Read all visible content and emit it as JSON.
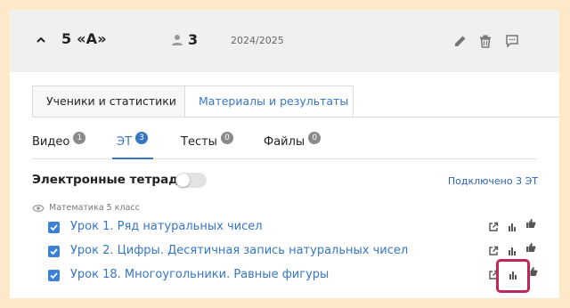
{
  "header": {
    "class_name": "5 «А»",
    "student_count": "3",
    "year": "2024/2025",
    "icons": [
      "chevron-up-icon",
      "person-icon",
      "pencil-icon",
      "trash-icon",
      "comment-icon"
    ]
  },
  "tabs": [
    {
      "label": "Ученики и статистики",
      "active": false
    },
    {
      "label": "Материалы и результаты",
      "active": true
    }
  ],
  "sub_tabs": [
    {
      "label": "Видео",
      "count": "1",
      "active": false
    },
    {
      "label": "ЭТ",
      "count": "3",
      "active": true
    },
    {
      "label": "Тесты",
      "count": "0",
      "active": false
    },
    {
      "label": "Файлы",
      "count": "0",
      "active": false
    }
  ],
  "section": {
    "title": "Электронные тетради",
    "toggle_on": false,
    "connected": "Подключено 3 ЭТ"
  },
  "subject": "Математика 5 класс",
  "lessons": [
    {
      "title": "Урок 1. Ряд натуральных чисел",
      "checked": true
    },
    {
      "title": "Урок 2. Цифры. Десятичная запись натуральных чисел",
      "checked": true
    },
    {
      "title": "Урок 18. Многоугольники. Равные фигуры",
      "checked": true
    }
  ],
  "row_icons": [
    "external-link-icon",
    "bar-chart-icon",
    "thumbs-up-icon"
  ],
  "colors": {
    "accent": "#3576c6",
    "highlight": "#c2245c",
    "background": "#fde9c8"
  }
}
